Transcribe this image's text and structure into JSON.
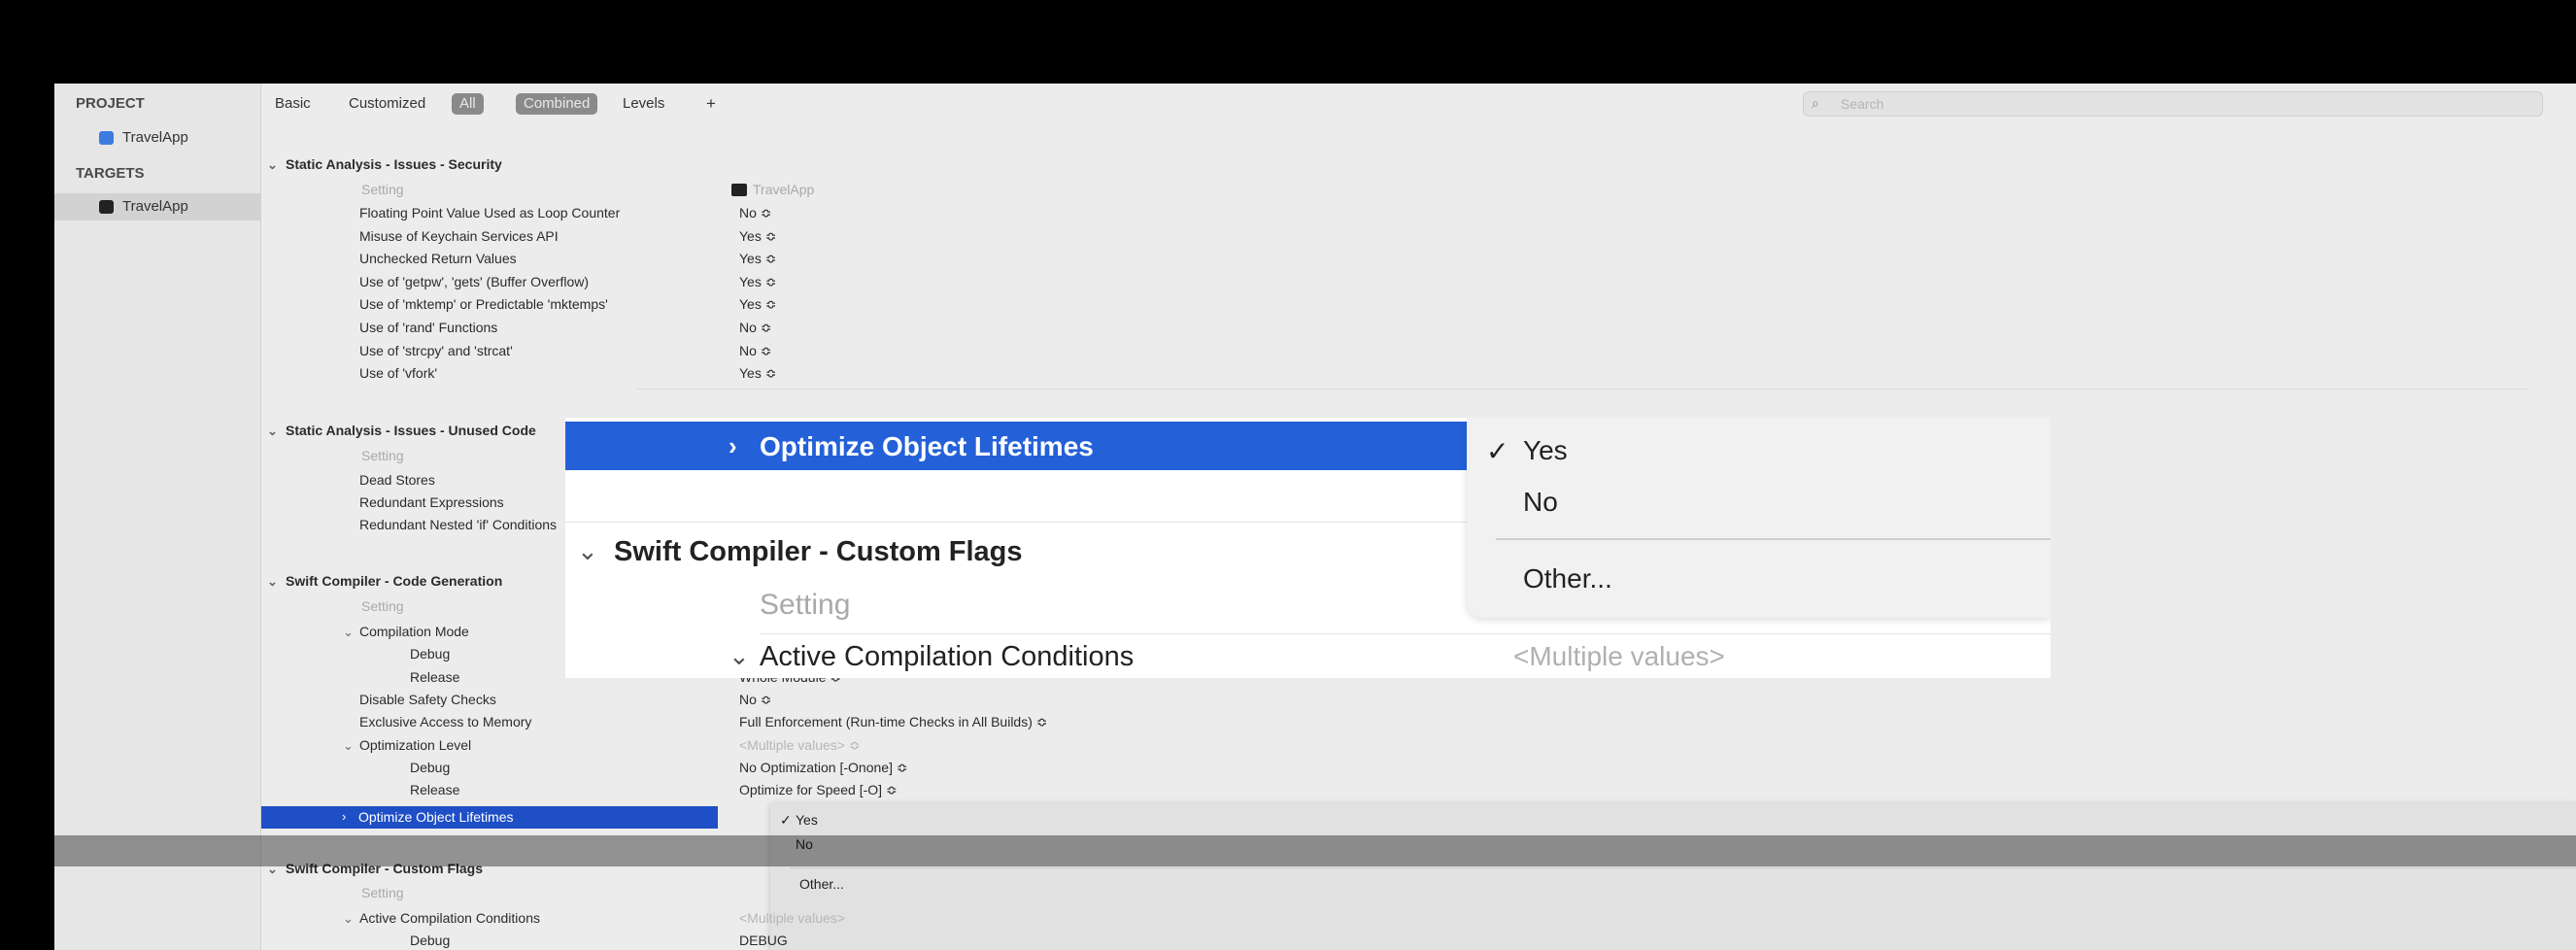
{
  "sidebar": {
    "project_heading": "PROJECT",
    "project_item": "TravelApp",
    "targets_heading": "TARGETS",
    "target_item": "TravelApp"
  },
  "toolbar": {
    "basic": "Basic",
    "customized": "Customized",
    "all": "All",
    "combined": "Combined",
    "levels": "Levels",
    "add": "+",
    "search_placeholder": "Search"
  },
  "sections": {
    "security": {
      "title": "Static Analysis - Issues - Security",
      "setting_col": "Setting",
      "target_col": "TravelApp",
      "rows": [
        {
          "k": "Floating Point Value Used as Loop Counter",
          "v": "No ≎"
        },
        {
          "k": "Misuse of Keychain Services API",
          "v": "Yes ≎"
        },
        {
          "k": "Unchecked Return Values",
          "v": "Yes ≎"
        },
        {
          "k": "Use of 'getpw', 'gets' (Buffer Overflow)",
          "v": "Yes ≎"
        },
        {
          "k": "Use of 'mktemp' or Predictable 'mktemps'",
          "v": "Yes ≎"
        },
        {
          "k": "Use of 'rand' Functions",
          "v": "No ≎"
        },
        {
          "k": "Use of 'strcpy' and 'strcat'",
          "v": "No ≎"
        },
        {
          "k": "Use of 'vfork'",
          "v": "Yes ≎"
        }
      ]
    },
    "unused": {
      "title": "Static Analysis - Issues - Unused Code",
      "setting_col": "Setting",
      "rows": [
        "Dead Stores",
        "Redundant Expressions",
        "Redundant Nested 'if' Conditions"
      ]
    },
    "codegen": {
      "title": "Swift Compiler - Code Generation",
      "setting_col": "Setting",
      "compilation_mode": "Compilation Mode",
      "debug": "Debug",
      "release": "Release",
      "release_value": "Whole Module ≎",
      "disable_safety": "Disable Safety Checks",
      "disable_safety_v": "No ≎",
      "exclusive": "Exclusive Access to Memory",
      "exclusive_v": "Full Enforcement (Run-time Checks in All Builds) ≎",
      "opt_level": "Optimization Level",
      "opt_level_v": "<Multiple values> ≎",
      "opt_debug_v": "No Optimization [-Onone] ≎",
      "opt_release_v": "Optimize for Speed [-O] ≎",
      "ool": "Optimize Object Lifetimes"
    },
    "flags": {
      "title": "Swift Compiler - Custom Flags",
      "setting_col": "Setting",
      "acc": "Active Compilation Conditions",
      "acc_v": "<Multiple values>",
      "debug": "Debug",
      "debug_v": "DEBUG"
    }
  },
  "popup": {
    "check": "✓",
    "yes": "Yes",
    "no": "No",
    "other": "Other..."
  },
  "zoom": {
    "ool": "Optimize Object Lifetimes",
    "section": "Swift Compiler - Custom Flags",
    "setting": "Setting",
    "acc": "Active Compilation Conditions",
    "acc_v": "<Multiple values>",
    "check": "✓",
    "yes": "Yes",
    "no": "No",
    "other": "Other..."
  }
}
